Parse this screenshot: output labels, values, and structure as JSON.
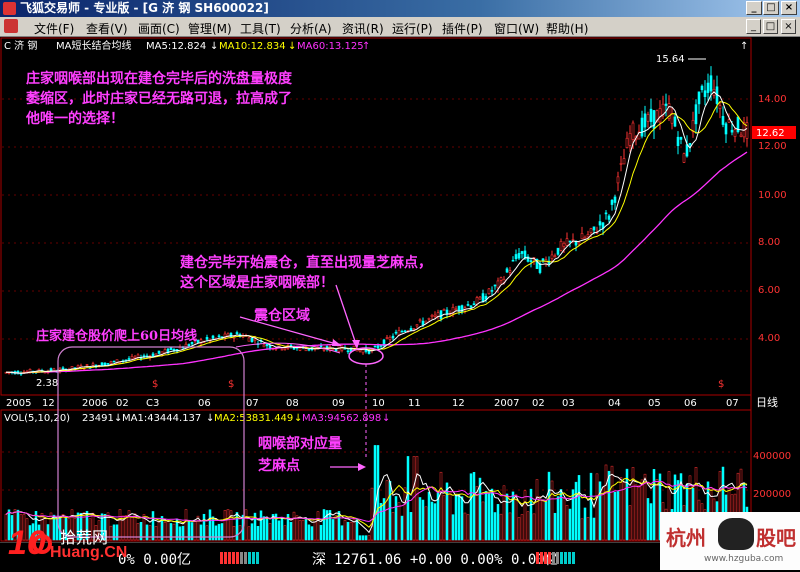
{
  "window": {
    "title": "飞狐交易师 - 专业版 - [G 济  钢 SH600022]",
    "minimize": "_",
    "maximize": "□",
    "close": "×"
  },
  "menu": {
    "items": [
      "文件(F)",
      "查看(V)",
      "画面(C)",
      "管理(M)",
      "工具(T)",
      "分析(A)",
      "资讯(R)",
      "运行(P)",
      "插件(P)",
      "窗口(W)",
      "帮助(H)"
    ]
  },
  "price_panel": {
    "stock_name": "C 济   钢",
    "indicator_name": "MA短长结合均线",
    "ma5_label": "MA5:12.824",
    "ma10_label": "MA10:12.834",
    "ma60_label": "MA60:13.125",
    "arrow_down": "↓",
    "arrow_up": "↑",
    "price_ticks": [
      "14.00",
      "12.00",
      "10.00",
      "8.00",
      "6.00",
      "4.00"
    ],
    "high_label": "15.64",
    "low_label": "2.38",
    "current_price": "12.62",
    "time_labels": [
      "2005",
      "12",
      "2006",
      "02",
      "C3",
      "06",
      "07",
      "08",
      "09",
      "10",
      "11",
      "12",
      "2007",
      "02",
      "03",
      "04",
      "05",
      "06",
      "07"
    ],
    "axis_unit": "日线",
    "dividend_marker": "$"
  },
  "volume_panel": {
    "vol_label": "VOL(5,10,20)",
    "vol_value": "23491",
    "ma1_label": "MA1:43444.137",
    "ma2_label": "MA2:53831.449",
    "ma3_label": "MA3:94562.898",
    "ticks": [
      "400000",
      "200000"
    ]
  },
  "annotations": {
    "text1": "庄家咽喉部出现在建仓完毕后的洗盘量极度萎缩区，此时庄家已经无路可退，拉高成了他唯一的选择！",
    "text2": "建仓完毕开始震仓，直至出现量芝麻点，这个区域是庄家咽喉部！",
    "text3": "震仓区域",
    "text4": "庄家建仓股价爬上60日均线",
    "text5": "咽喉部对应量芝麻点"
  },
  "status": {
    "sh_tail": "0% 0.00亿",
    "sz_label": "深",
    "sz_value": "12761.06 +0.00 0.00% 0.00亿"
  },
  "watermarks": {
    "left_logo": "10",
    "left_text": "拾荒网",
    "left_domain": "Huang.CN",
    "right_text1": "杭州",
    "right_text2": "股吧",
    "right_domain": "www.hzguba.com"
  },
  "colors": {
    "annotation": "#ff3fff",
    "ma60": "#ff33ff",
    "ma5": "#ffffff",
    "ma10": "#ffff00",
    "up_candle": "#ff3333",
    "down_candle": "#00ffff",
    "axis": "#cc0000"
  }
}
